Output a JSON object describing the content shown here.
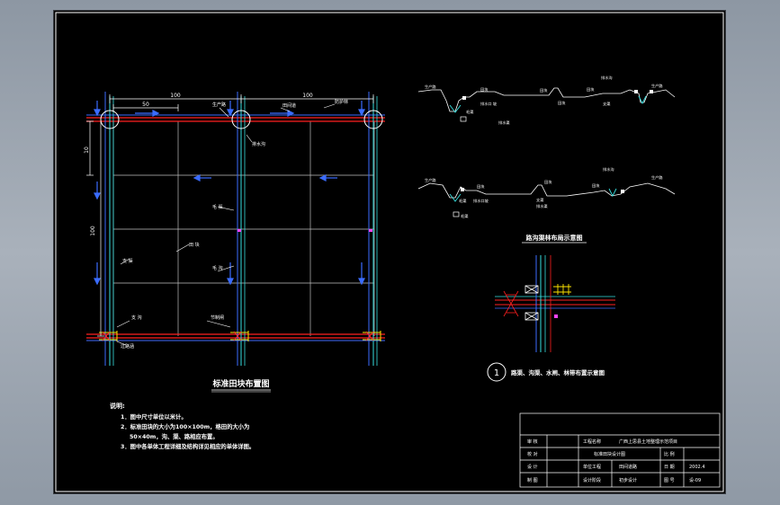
{
  "layout_plan": {
    "title": "标准田块布置图",
    "dim_top_left": "100",
    "dim_top_right": "100",
    "dim_inner_left": "50",
    "dim_left_upper": "10",
    "dim_left_main": "100",
    "callouts": {
      "tree_row": "防护林",
      "field_road": "田间道",
      "farm_road": "生产路",
      "drain_ditch": "排水沟",
      "field_block": "田 块",
      "branch_canal": "支 渠",
      "drain_channel": "毛 渠",
      "lateral_channel": "毛 沟",
      "branch_ditch": "支 沟",
      "crossing": "过路涵",
      "drop": "节制闸",
      "bridge": "水利桥"
    }
  },
  "section_upper": {
    "labels": [
      "生产路",
      "田块",
      "毛渠",
      "田块",
      "排水口 坡",
      "田块",
      "田块",
      "生产路",
      "排水沟",
      "支渠",
      "田块",
      "排水渠"
    ]
  },
  "section_lower": {
    "labels": [
      "生产路",
      "田块",
      "毛渠",
      "排水口坡",
      "毛渠",
      "田块",
      "田块",
      "生产路",
      "支渠",
      "排水渠",
      "排水沟"
    ]
  },
  "detail": {
    "title": "路沟渠林布局示意图",
    "marker": "1",
    "caption": "路渠、沟渠、水闸、林带布置示意图"
  },
  "notes": {
    "heading": "说明:",
    "items": [
      "1．图中尺寸单位以米计。",
      "2．标准田块的大小为100×100m，格田的大小为",
      "50×40m，沟、渠、路相应布置。",
      "3．图中各单体工程详细及结构详见相应的单体详图。"
    ]
  },
  "title_block": {
    "project_label": "工程名称",
    "project_name": "广西上思县土地整理示范项目",
    "r1": [
      "审 核",
      "",
      "",
      ""
    ],
    "r2": [
      "校 对",
      "标准田块设计图",
      "比 例",
      ""
    ],
    "r3": [
      "设 计",
      "单位工程",
      "田间道路",
      "日 期",
      "2002.4"
    ],
    "r4": [
      "制 图",
      "设计阶段",
      "初步设计",
      "图 号",
      "设-09"
    ]
  }
}
